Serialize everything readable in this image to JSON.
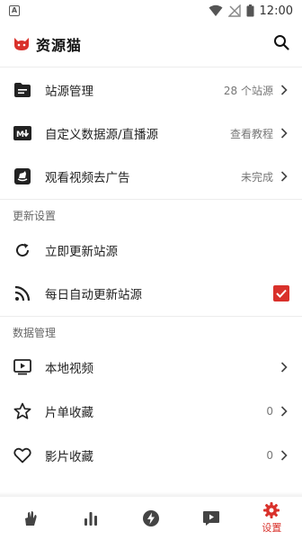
{
  "status_bar": {
    "time": "12:00",
    "notification_icon": "A"
  },
  "app_bar": {
    "title": "资源猫"
  },
  "main_items": [
    {
      "label": "站源管理",
      "value": "28 个站源",
      "icon": "folder-icon"
    },
    {
      "label": "自定义数据源/直播源",
      "value": "查看教程",
      "icon": "markdown-icon"
    },
    {
      "label": "观看视频去广告",
      "value": "未完成",
      "icon": "rocking-horse-icon"
    }
  ],
  "update_section": {
    "header": "更新设置",
    "items": [
      {
        "label": "立即更新站源",
        "icon": "refresh-icon"
      },
      {
        "label": "每日自动更新站源",
        "icon": "rss-icon",
        "checked": true
      }
    ]
  },
  "data_section": {
    "header": "数据管理",
    "items": [
      {
        "label": "本地视频",
        "value": "",
        "icon": "play-box-icon"
      },
      {
        "label": "片单收藏",
        "value": "0",
        "icon": "star-icon"
      },
      {
        "label": "影片收藏",
        "value": "0",
        "icon": "heart-icon"
      }
    ]
  },
  "bottom_nav": {
    "tabs": [
      {
        "name": "hand-icon",
        "label": ""
      },
      {
        "name": "chart-icon",
        "label": ""
      },
      {
        "name": "bolt-icon",
        "label": ""
      },
      {
        "name": "tv-play-icon",
        "label": ""
      },
      {
        "name": "gear-icon",
        "label": "设置",
        "active": true
      }
    ]
  },
  "colors": {
    "accent": "#d9312b",
    "text": "#222222",
    "muted": "#777777",
    "divider": "#ececec"
  }
}
